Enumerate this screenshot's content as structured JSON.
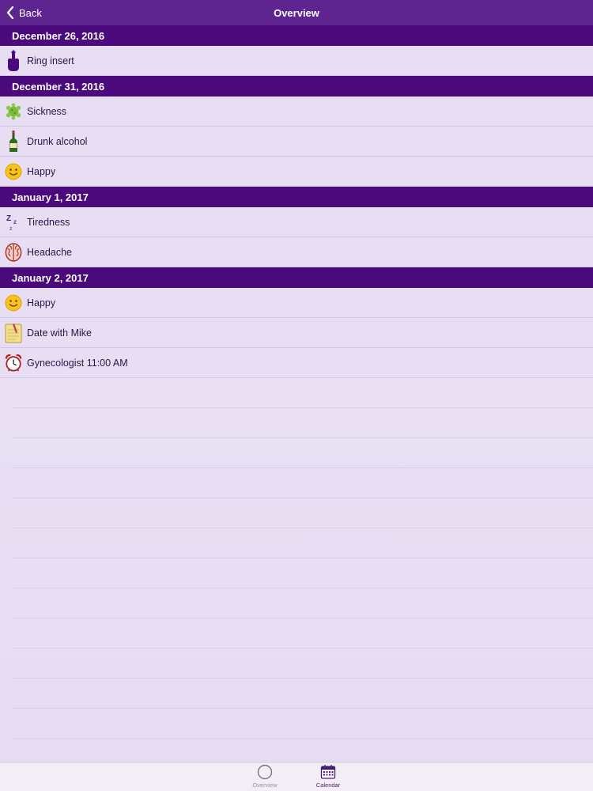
{
  "navbar": {
    "back_label": "Back",
    "title": "Overview"
  },
  "sections": [
    {
      "date": "December 26, 2016",
      "items": [
        {
          "label": "Ring insert",
          "icon": "hand-pointing-icon"
        }
      ]
    },
    {
      "date": "December 31, 2016",
      "items": [
        {
          "label": "Sickness",
          "icon": "virus-icon"
        },
        {
          "label": "Drunk alcohol",
          "icon": "wine-bottle-icon"
        },
        {
          "label": "Happy",
          "icon": "smiley-icon"
        }
      ]
    },
    {
      "date": "January 1, 2017",
      "items": [
        {
          "label": "Tiredness",
          "icon": "sleep-zzz-icon"
        },
        {
          "label": "Headache",
          "icon": "brain-icon"
        }
      ]
    },
    {
      "date": "January 2, 2017",
      "items": [
        {
          "label": "Happy",
          "icon": "smiley-icon"
        },
        {
          "label": "Date with Mike",
          "icon": "note-icon"
        },
        {
          "label": "Gynecologist 11:00 AM",
          "icon": "alarm-clock-icon"
        }
      ]
    }
  ],
  "tabbar": {
    "tabs": [
      {
        "label": "Overview",
        "icon": "circle-icon",
        "selected": false
      },
      {
        "label": "Calendar",
        "icon": "calendar-icon",
        "selected": true
      }
    ]
  },
  "colors": {
    "navbar": "#5e2591",
    "section_header": "#4a0a7c",
    "row_background": "#e8def3",
    "tab_selected": "#4a1a7a"
  }
}
